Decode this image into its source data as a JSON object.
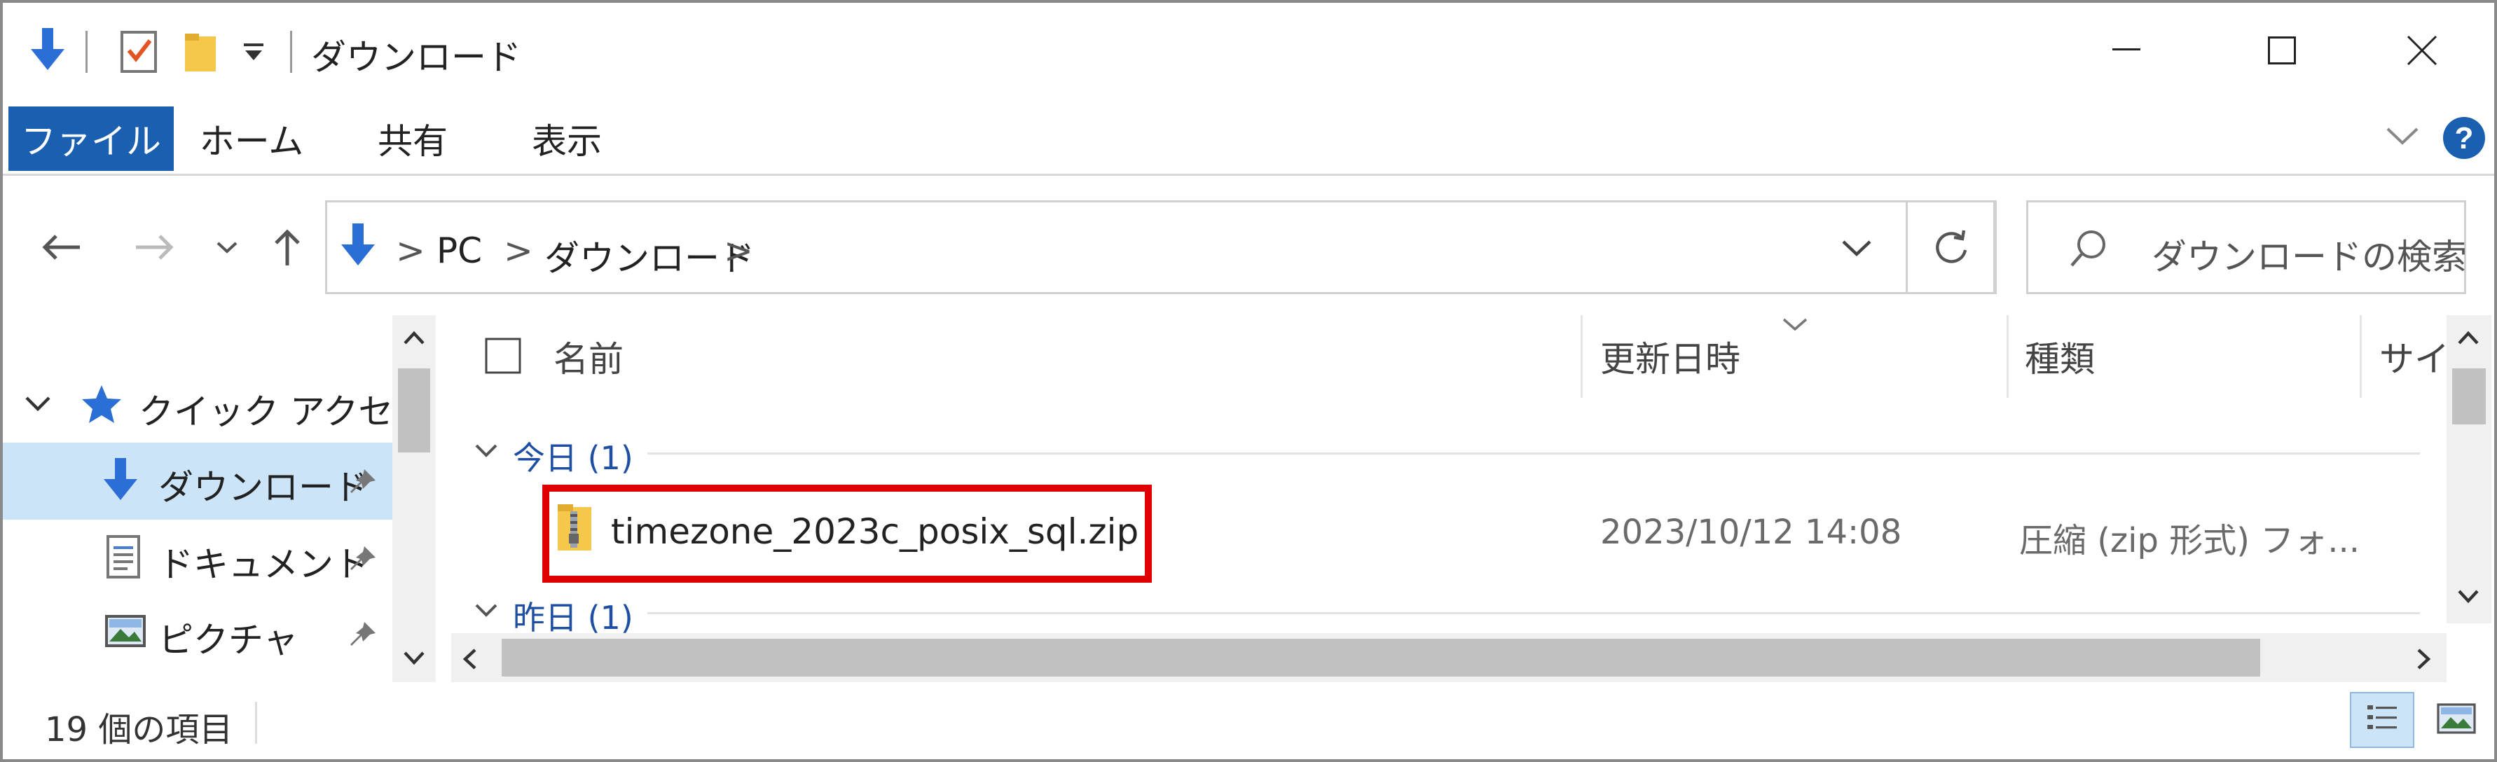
{
  "window": {
    "title": "ダウンロード"
  },
  "ribbon": {
    "tabs": [
      {
        "label": "ファイル"
      },
      {
        "label": "ホーム"
      },
      {
        "label": "共有"
      },
      {
        "label": "表示"
      }
    ]
  },
  "address_bar": {
    "breadcrumb": [
      "PC",
      "ダウンロード"
    ],
    "separator": ">"
  },
  "search": {
    "placeholder": "ダウンロードの検索"
  },
  "nav_pane": {
    "quick_access": "クイック アクセス",
    "items": [
      {
        "label": "ダウンロード",
        "icon": "download-arrow-icon",
        "pinned": true,
        "selected": true
      },
      {
        "label": "ドキュメント",
        "icon": "document-icon",
        "pinned": true,
        "selected": false
      },
      {
        "label": "ピクチャ",
        "icon": "picture-icon",
        "pinned": true,
        "selected": false
      }
    ]
  },
  "columns": {
    "name": "名前",
    "date": "更新日時",
    "type": "種類",
    "size": "サイズ"
  },
  "groups": [
    {
      "label": "今日 (1)"
    },
    {
      "label": "昨日 (1)"
    }
  ],
  "files": [
    {
      "name": "timezone_2023c_posix_sql.zip",
      "date": "2023/10/12 14:08",
      "type": "圧縮 (zip 形式) フォ..."
    }
  ],
  "status_bar": {
    "item_count": "19 個の項目"
  },
  "colors": {
    "accent": "#1a5fb0",
    "selection": "#cce4f7",
    "highlight": "#e00000",
    "help": "#1a5fb0"
  }
}
